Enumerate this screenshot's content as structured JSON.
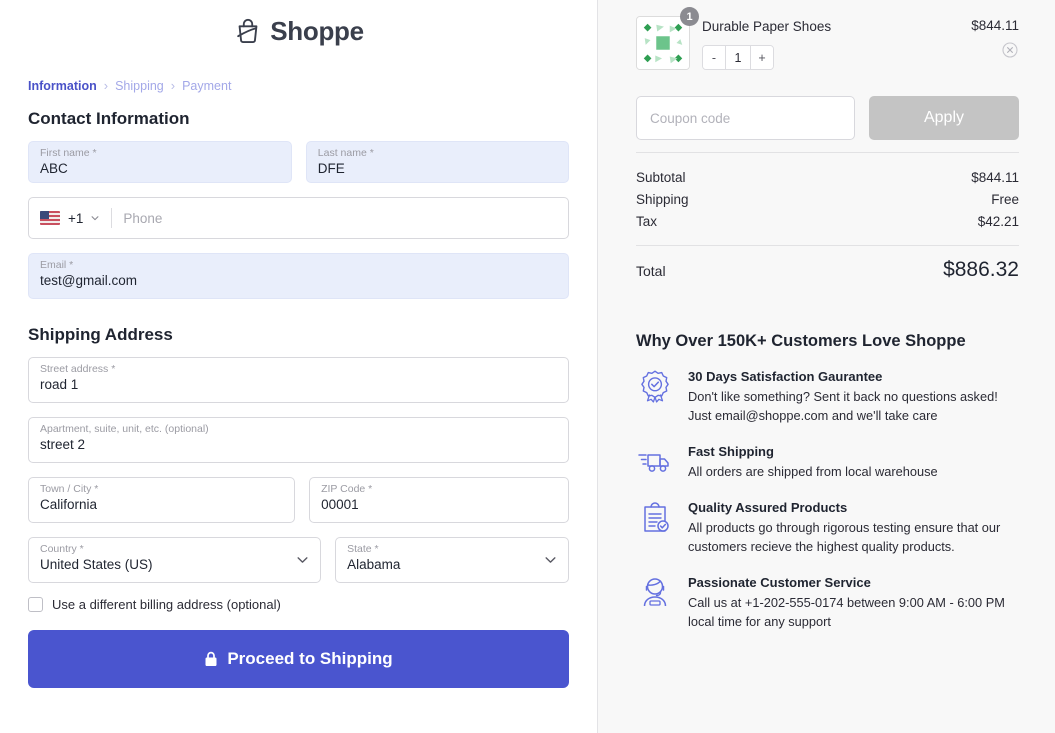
{
  "brand": {
    "name": "Shoppe",
    "logo_icon": "shopping-bag-icon"
  },
  "breadcrumb": {
    "steps": [
      {
        "label": "Information",
        "state": "active"
      },
      {
        "label": "Shipping",
        "state": "inactive"
      },
      {
        "label": "Payment",
        "state": "inactive"
      }
    ],
    "separator": "›"
  },
  "contact": {
    "heading": "Contact Information",
    "first_name": {
      "label": "First name *",
      "value": "ABC"
    },
    "last_name": {
      "label": "Last name *",
      "value": "DFE"
    },
    "phone": {
      "country_flag": "us-flag-icon",
      "dial_code": "+1",
      "placeholder": "Phone",
      "value": ""
    },
    "email": {
      "label": "Email *",
      "value": "test@gmail.com"
    }
  },
  "shipping": {
    "heading": "Shipping Address",
    "street": {
      "label": "Street address *",
      "value": "road 1"
    },
    "apartment": {
      "label": "Apartment, suite, unit, etc. (optional)",
      "value": "street 2"
    },
    "city": {
      "label": "Town / City *",
      "value": "California"
    },
    "zip": {
      "label": "ZIP Code *",
      "value": "00001"
    },
    "country": {
      "label": "Country *",
      "value": "United States (US)"
    },
    "state": {
      "label": "State *",
      "value": "Alabama"
    },
    "billing_checkbox": {
      "label": "Use a different billing address (optional)",
      "checked": false
    }
  },
  "submit": {
    "label": "Proceed to Shipping",
    "icon": "lock-icon",
    "color": "#4a55cf"
  },
  "cart": {
    "item": {
      "name": "Durable Paper Shoes",
      "price": "$844.11",
      "quantity_badge": "1",
      "quantity": "1",
      "decrement_label": "-",
      "increment_label": "+",
      "remove_icon": "close-circle-icon",
      "thumbnail_icon": "product-placeholder-icon"
    }
  },
  "coupon": {
    "placeholder": "Coupon code",
    "value": "",
    "apply_label": "Apply",
    "apply_color": "#c4c4c4"
  },
  "totals": {
    "rows": [
      {
        "label": "Subtotal",
        "value": "$844.11"
      },
      {
        "label": "Shipping",
        "value": "Free"
      },
      {
        "label": "Tax",
        "value": "$42.21"
      }
    ],
    "total": {
      "label": "Total",
      "value": "$886.32"
    }
  },
  "why": {
    "heading": "Why Over 150K+ Customers Love Shoppe",
    "accent_color": "#6470e0",
    "items": [
      {
        "icon": "award-badge-icon",
        "title": "30 Days Satisfaction Gaurantee",
        "desc": "Don't like something? Sent it back no questions asked! Just email@shoppe.com and we'll take care"
      },
      {
        "icon": "truck-icon",
        "title": "Fast Shipping",
        "desc": "All orders are shipped from local warehouse"
      },
      {
        "icon": "clipboard-check-icon",
        "title": "Quality Assured Products",
        "desc": "All products go through rigorous testing ensure that our customers recieve the highest quality products."
      },
      {
        "icon": "headset-support-icon",
        "title": "Passionate Customer Service",
        "desc": "Call us at +1-202-555-0174 between 9:00 AM - 6:00 PM local time for any support"
      }
    ]
  }
}
